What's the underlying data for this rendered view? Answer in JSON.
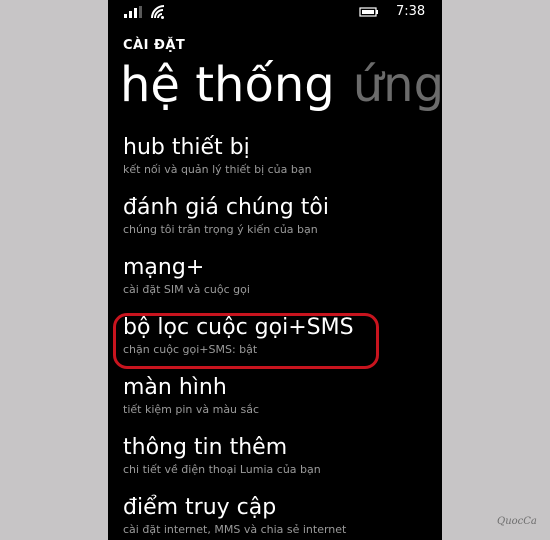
{
  "status": {
    "time": "7:38"
  },
  "header": {
    "section": "CÀI ĐẶT",
    "pivot_active": "hệ thống",
    "pivot_next": "ứng d"
  },
  "settings": [
    {
      "title": "hub thiết bị",
      "subtitle": "kết nối và quản lý thiết bị của bạn"
    },
    {
      "title": "đánh giá chúng tôi",
      "subtitle": "chúng tôi trân trọng ý kiến của bạn"
    },
    {
      "title": "mạng+",
      "subtitle": "cài đặt SIM và cuộc gọi"
    },
    {
      "title": "bộ lọc cuộc gọi+SMS",
      "subtitle": "chặn cuộc gọi+SMS: bật"
    },
    {
      "title": "màn hình",
      "subtitle": "tiết kiệm pin và màu sắc"
    },
    {
      "title": "thông tin thêm",
      "subtitle": "chi tiết về điện thoại Lumia của bạn"
    },
    {
      "title": "điểm truy cập",
      "subtitle": "cài đặt internet, MMS và chia sẻ internet"
    }
  ],
  "highlight_color": "#c8141e",
  "watermark": "QuocCa",
  "icons": [
    "signal-icon",
    "wifi-icon",
    "battery-icon"
  ]
}
